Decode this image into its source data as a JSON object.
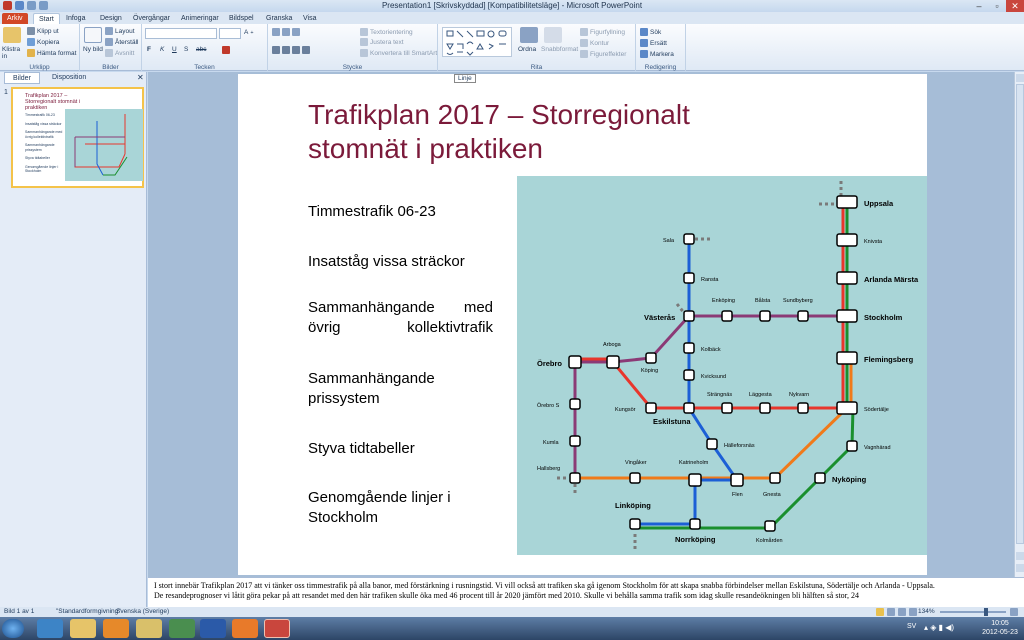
{
  "window": {
    "title": "Presentation1 [Skrivskyddad] [Kompatibilitetsläge] - Microsoft PowerPoint"
  },
  "tabs": [
    "Arkiv",
    "Start",
    "Infoga",
    "Design",
    "Övergångar",
    "Animeringar",
    "Bildspel",
    "Granska",
    "Visa"
  ],
  "ribbon": {
    "clipboard": {
      "label": "Urklipp",
      "paste": "Klistra in",
      "cut": "Klipp ut",
      "copy": "Kopiera",
      "format": "Hämta format"
    },
    "slides": {
      "label": "Bilder",
      "new": "Ny bild",
      "layout": "Layout",
      "reset": "Återställ",
      "section": "Avsnitt"
    },
    "font": {
      "label": "Tecken",
      "bold": "F",
      "italic": "K",
      "underline": "U",
      "strike": "S",
      "abc": "abc"
    },
    "paragraph": {
      "label": "Stycke",
      "textdir": "Textorientering",
      "align": "Justera text",
      "smartart": "Konvertera till SmartArt"
    },
    "drawing": {
      "label": "Rita",
      "arrange": "Ordna",
      "quick": "Snabbformat",
      "fill": "Figurfyllning",
      "outline": "Kontur",
      "effects": "Figureffekter"
    },
    "editing": {
      "label": "Redigering",
      "find": "Sök",
      "replace": "Ersätt",
      "select": "Markera"
    }
  },
  "tooltip": "Linje",
  "pane": {
    "tab_slides": "Bilder",
    "tab_outline": "Disposition",
    "slide_number": "1"
  },
  "slide": {
    "title": "Trafikplan 2017 – Storregionalt stomnät i praktiken",
    "bullets": [
      "Timmestrafik 06-23",
      "Insatståg vissa sträckor",
      "Sammanhängande med övrig kollektivtrafik",
      "Sammanhängande prissystem",
      "Styva tidtabeller",
      "Genomgående linjer i Stockholm"
    ],
    "map": {
      "colors": {
        "purple": "#8b3a76",
        "red": "#e8362c",
        "orange": "#f07a1a",
        "blue": "#1c5fd6",
        "green": "#1a8f2e",
        "water": "#a9d5d7"
      },
      "stations": [
        {
          "name": "Uppsala",
          "bold": true
        },
        {
          "name": "Knivsta",
          "bold": false
        },
        {
          "name": "Arlanda Märsta",
          "bold": true
        },
        {
          "name": "Stockholm",
          "bold": true
        },
        {
          "name": "Flemingsberg",
          "bold": true
        },
        {
          "name": "Södertälje",
          "bold": false
        },
        {
          "name": "Vagnhärad",
          "bold": false
        },
        {
          "name": "Nyköping",
          "bold": true
        },
        {
          "name": "Kolmården",
          "bold": false
        },
        {
          "name": "Norrköping",
          "bold": true
        },
        {
          "name": "Linköping",
          "bold": true
        },
        {
          "name": "Sala",
          "bold": false
        },
        {
          "name": "Ransta",
          "bold": false
        },
        {
          "name": "Västerås",
          "bold": true
        },
        {
          "name": "Enköping",
          "bold": false
        },
        {
          "name": "Bålsta",
          "bold": false
        },
        {
          "name": "Sundbyberg",
          "bold": false
        },
        {
          "name": "Kolbäck",
          "bold": false
        },
        {
          "name": "Kvicksund",
          "bold": false
        },
        {
          "name": "Eskilstuna",
          "bold": true
        },
        {
          "name": "Strängnäs",
          "bold": false
        },
        {
          "name": "Läggesta",
          "bold": false
        },
        {
          "name": "Nykvarn",
          "bold": false
        },
        {
          "name": "Hälleforsnäs",
          "bold": false
        },
        {
          "name": "Flen",
          "bold": false
        },
        {
          "name": "Gnesta",
          "bold": false
        },
        {
          "name": "Katrineholm",
          "bold": false
        },
        {
          "name": "Vingåker",
          "bold": false
        },
        {
          "name": "Hallsberg",
          "bold": false
        },
        {
          "name": "Kumla",
          "bold": false
        },
        {
          "name": "Örebro S",
          "bold": false
        },
        {
          "name": "Örebro",
          "bold": true
        },
        {
          "name": "Arboga",
          "bold": false
        },
        {
          "name": "Köping",
          "bold": false
        },
        {
          "name": "Kungsör",
          "bold": false
        }
      ]
    }
  },
  "thumbnail": {
    "title": "Trafikplan 2017 – Storregionalt stomnät i praktiken",
    "bullets": [
      "Timmestrafik 06-23",
      "Insatståg vissa sträckor",
      "Sammanhängande med övrig kollektivtrafik",
      "Sammanhängande prissystem",
      "Styva tidtabeller",
      "Genomgående linjer i Stockholm"
    ]
  },
  "notes": "I stort innebär Trafikplan 2017 att vi tänker oss timmestrafik på alla banor, med förstärkning i rusningstid. Vi vill också att trafiken ska gå igenom Stockholm för att skapa snabba förbindelser mellan Eskilstuna, Södertälje och Arlanda - Uppsala.",
  "notes_line2": "De resandeprognoser vi låtit göra pekar på att resandet med den här trafiken skulle öka med 46 procent till år 2020 jämfört med 2010. Skulle vi behålla samma trafik som idag skulle resandeökningen bli hälften så stor, 24",
  "status": {
    "slide": "Bild 1 av 1",
    "theme": "\"Standardformgivning\"",
    "lang": "Svenska (Sverige)",
    "zoom": "134%"
  },
  "taskbar": {
    "lang": "SV",
    "time": "10:05",
    "date": "2012-05-23"
  }
}
